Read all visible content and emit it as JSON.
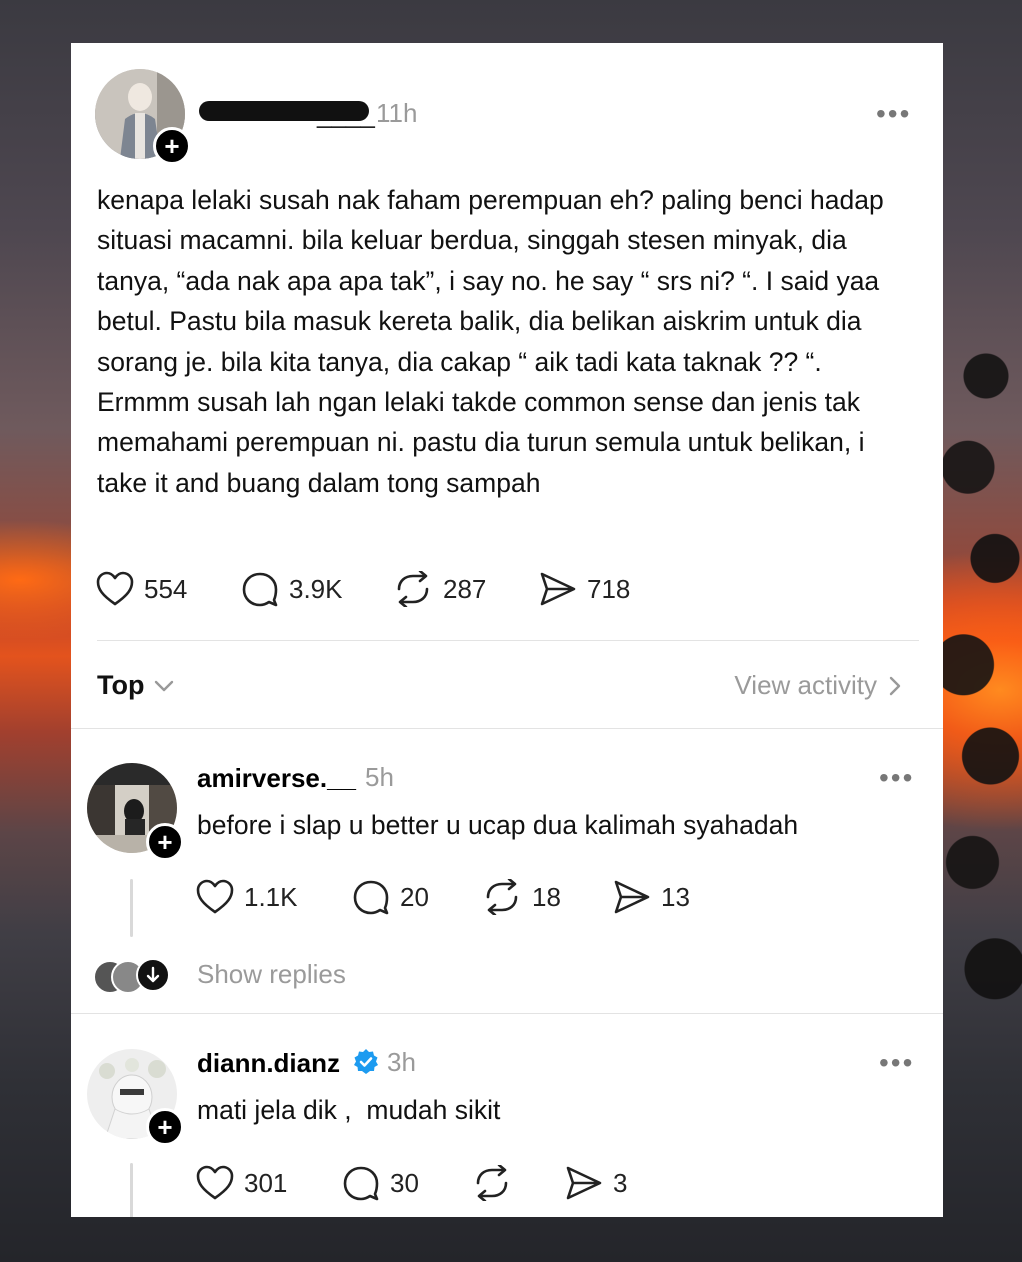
{
  "post": {
    "username_redacted": "dia■■girl____",
    "time": "11h",
    "more": "•••",
    "text": "kenapa lelaki susah nak faham perempuan eh? paling benci hadap situasi macamni. bila keluar berdua, singgah stesen minyak, dia tanya, “ada nak apa apa tak”, i say no. he say “ srs ni? “. I said yaa betul. Pastu bila masuk kereta balik, dia belikan aiskrim untuk dia sorang je. bila kita tanya, dia cakap “ aik tadi kata taknak ?? “. Ermmm susah lah ngan lelaki takde common sense dan jenis tak memahami perempuan ni. pastu dia turun semula untuk belikan, i take it and buang dalam tong sampah",
    "likes": "554",
    "replies": "3.9K",
    "reposts": "287",
    "shares": "718"
  },
  "sort": {
    "label": "Top",
    "view_activity": "View activity"
  },
  "comments": [
    {
      "username": "amirverse.__",
      "time": "5h",
      "more": "•••",
      "text": "before i slap u better u ucap dua kalimah syahadah",
      "likes": "1.1K",
      "replies": "20",
      "reposts": "18",
      "shares": "13",
      "show_replies": "Show replies"
    },
    {
      "username": "diann.dianz",
      "verified": true,
      "time": "3h",
      "more": "•••",
      "text": "mati jela dik ,  mudah sikit",
      "likes": "301",
      "replies": "30",
      "reposts": "",
      "shares": "3"
    }
  ],
  "icons": {
    "like": "heart-icon",
    "reply": "comment-bubble-icon",
    "repost": "repost-icon",
    "share": "send-icon",
    "verified": "verified-badge-icon"
  },
  "colors": {
    "verified": "#1d9bf0",
    "muted": "#9a9a9a"
  }
}
